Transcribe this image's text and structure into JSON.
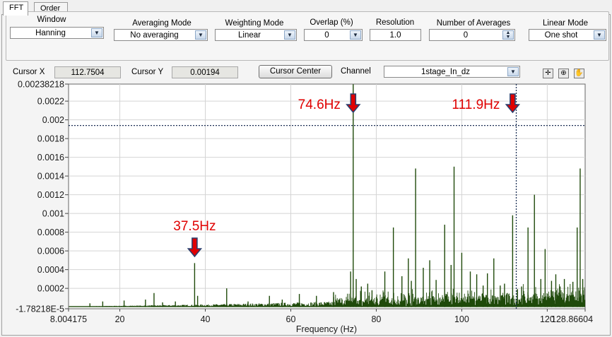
{
  "tabs": [
    {
      "label": "FFT",
      "active": true
    },
    {
      "label": "Order",
      "active": false
    }
  ],
  "controls": {
    "window": {
      "label": "Window",
      "value": "Hanning"
    },
    "averaging_mode": {
      "label": "Averaging Mode",
      "value": "No averaging"
    },
    "weighting_mode": {
      "label": "Weighting Mode",
      "value": "Linear"
    },
    "overlap": {
      "label": "Overlap (%)",
      "value": "0"
    },
    "resolution": {
      "label": "Resolution",
      "value": "1.0"
    },
    "number_of_averages": {
      "label": "Number of Averages",
      "value": "0"
    },
    "linear_mode": {
      "label": "Linear Mode",
      "value": "One shot"
    }
  },
  "cursor": {
    "x_label": "Cursor X",
    "x_value": "112.7504",
    "y_label": "Cursor Y",
    "y_value": "0.00194",
    "center_button": "Cursor Center",
    "channel_label": "Channel",
    "channel_value": "1stage_In_dz"
  },
  "icons": [
    "crosshair-icon",
    "zoom-icon",
    "pan-hand-icon"
  ],
  "colors": {
    "signal": "#1f4a0a",
    "annotation": "#e00000",
    "arrow": "#2b3f6e",
    "cursor": "#1c2f55"
  },
  "chart_data": {
    "type": "line",
    "xlabel": "Frequency (Hz)",
    "ylabel": "",
    "xlim": [
      8.004175,
      128.86604
    ],
    "ylim": [
      -1.78218e-05,
      0.00238218
    ],
    "x_tick_labels": [
      {
        "value": 8.004175,
        "label": "8.004175"
      },
      {
        "value": 20,
        "label": "20"
      },
      {
        "value": 40,
        "label": "40"
      },
      {
        "value": 60,
        "label": "60"
      },
      {
        "value": 80,
        "label": "80"
      },
      {
        "value": 100,
        "label": "100"
      },
      {
        "value": 120,
        "label": "120"
      },
      {
        "value": 128.86604,
        "label": "128.86604"
      }
    ],
    "y_tick_labels": [
      {
        "value": -1.78218e-05,
        "label": "-1.78218E-5"
      },
      {
        "value": 0.0002,
        "label": "0.0002"
      },
      {
        "value": 0.0004,
        "label": "0.0004"
      },
      {
        "value": 0.0006,
        "label": "0.0006"
      },
      {
        "value": 0.0008,
        "label": "0.0008"
      },
      {
        "value": 0.001,
        "label": "0.001"
      },
      {
        "value": 0.0012,
        "label": "0.0012"
      },
      {
        "value": 0.0014,
        "label": "0.0014"
      },
      {
        "value": 0.0016,
        "label": "0.0016"
      },
      {
        "value": 0.0018,
        "label": "0.0018"
      },
      {
        "value": 0.002,
        "label": "0.002"
      },
      {
        "value": 0.0022,
        "label": "0.0022"
      },
      {
        "value": 0.00238218,
        "label": "0.00238218"
      }
    ],
    "grid": true,
    "cursor": {
      "x": 112.7504,
      "y": 0.00194
    },
    "annotations": [
      {
        "label": "37.5Hz",
        "x": 37.5
      },
      {
        "label": "74.6Hz",
        "x": 74.6
      },
      {
        "label": "111.9Hz",
        "x": 111.9
      }
    ],
    "peaks": [
      [
        13,
        4e-05
      ],
      [
        16,
        6e-05
      ],
      [
        21,
        7e-05
      ],
      [
        26,
        8e-05
      ],
      [
        28,
        0.00015
      ],
      [
        30,
        5e-05
      ],
      [
        33,
        6e-05
      ],
      [
        37.5,
        0.00047
      ],
      [
        38.2,
        0.00012
      ],
      [
        45,
        0.0002
      ],
      [
        50,
        6e-05
      ],
      [
        55,
        0.00012
      ],
      [
        58,
        8e-05
      ],
      [
        62,
        0.00014
      ],
      [
        66,
        0.00012
      ],
      [
        70,
        0.00016
      ],
      [
        72,
        8e-05
      ],
      [
        74,
        0.00038
      ],
      [
        74.6,
        0.00238
      ],
      [
        75.3,
        0.0003
      ],
      [
        76.5,
        0.00022
      ],
      [
        78,
        0.00025
      ],
      [
        79,
        0.00018
      ],
      [
        82,
        0.00038
      ],
      [
        84,
        0.00085
      ],
      [
        86,
        0.00033
      ],
      [
        87.5,
        0.00052
      ],
      [
        88.2,
        0.00028
      ],
      [
        89.2,
        0.00148
      ],
      [
        91,
        0.00042
      ],
      [
        92.5,
        0.0005
      ],
      [
        94,
        0.00029
      ],
      [
        96,
        0.00088
      ],
      [
        97.5,
        0.00045
      ],
      [
        98.2,
        0.0015
      ],
      [
        100,
        0.00058
      ],
      [
        102,
        0.00038
      ],
      [
        103.5,
        0.00035
      ],
      [
        105,
        0.00023
      ],
      [
        106,
        0.00036
      ],
      [
        107.5,
        0.00052
      ],
      [
        109,
        0.00023
      ],
      [
        110,
        0.00025
      ],
      [
        111.9,
        0.00098
      ],
      [
        113,
        0.00019
      ],
      [
        114,
        0.00022
      ],
      [
        115.5,
        0.00085
      ],
      [
        117,
        0.0012
      ],
      [
        118.5,
        0.0003
      ],
      [
        119.5,
        0.00062
      ],
      [
        121,
        0.00028
      ],
      [
        122,
        0.00035
      ],
      [
        123,
        0.00022
      ],
      [
        124,
        0.0003
      ],
      [
        126,
        0.00027
      ],
      [
        127,
        0.00085
      ],
      [
        127.7,
        0.00148
      ],
      [
        128.3,
        0.0003
      ]
    ]
  }
}
